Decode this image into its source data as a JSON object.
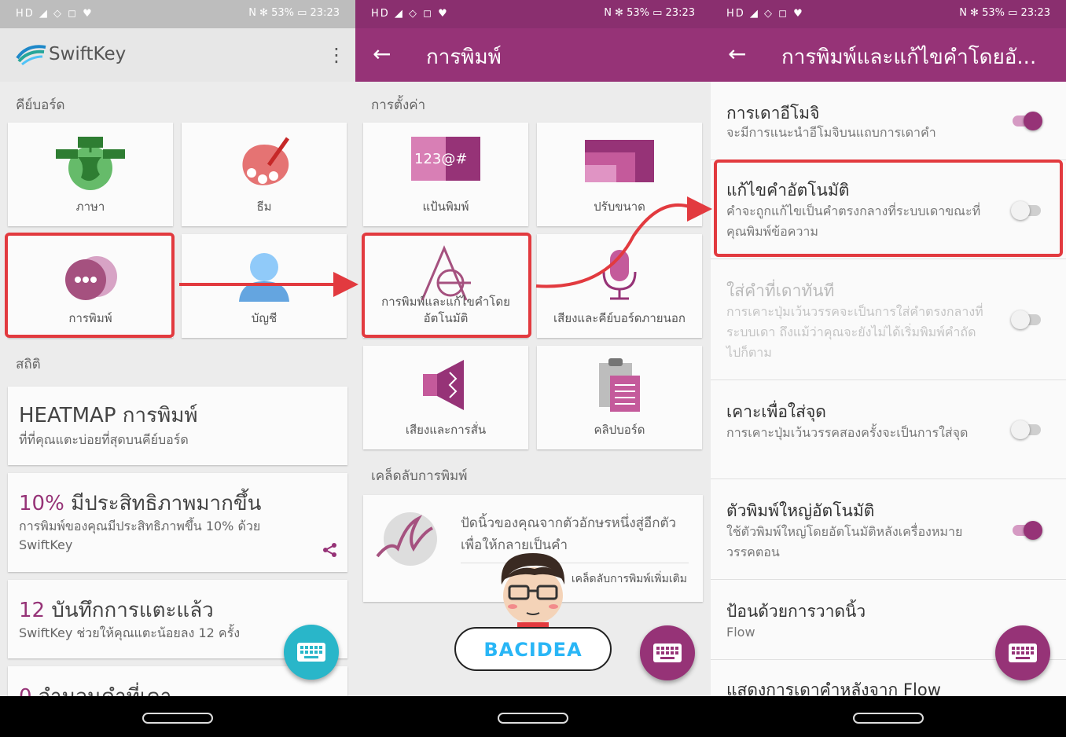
{
  "status": {
    "left_icons": "HD ◢ ◇ ◻ ♥",
    "right_text": "N ✻ 53% ▭ 23:23"
  },
  "panel1": {
    "app_name": "SwiftKey",
    "more_icon": "⋮",
    "keyboard_section": "คีย์บอร์ด",
    "tiles": [
      {
        "label": "ภาษา",
        "icon": "globe-icon"
      },
      {
        "label": "ธีม",
        "icon": "palette-icon"
      },
      {
        "label": "การพิมพ์",
        "icon": "chat-bubbles-icon"
      },
      {
        "label": "บัญชี",
        "icon": "account-icon"
      }
    ],
    "stats_section": "สถิติ",
    "cards": [
      {
        "title": "HEATMAP การพิมพ์",
        "subtitle": "ที่ที่คุณแตะบ่อยที่สุดบนคีย์บอร์ด"
      },
      {
        "number": "10%",
        "title": "มีประสิทธิภาพมากขึ้น",
        "subtitle": "การพิมพ์ของคุณมีประสิทธิภาพขึ้น 10% ด้วย SwiftKey"
      },
      {
        "number": "12",
        "title": "บันทึกการแตะแล้ว",
        "subtitle": "SwiftKey ช่วยให้คุณแตะน้อยลง 12 ครั้ง"
      },
      {
        "number": "0",
        "title": "จำนวนคำที่เดา"
      }
    ]
  },
  "panel2": {
    "back": "←",
    "title": "การพิมพ์",
    "settings_section": "การตั้งค่า",
    "tiles": [
      {
        "label": "แป้นพิมพ์",
        "icon": "keyboard-layout-icon"
      },
      {
        "label": "ปรับขนาด",
        "icon": "resize-icon"
      },
      {
        "label": "การพิมพ์และแก้ไขคำโดยอัตโนมัติ",
        "icon": "typing-autocorrect-icon"
      },
      {
        "label": "เสียงและคีย์บอร์ดภายนอก",
        "icon": "microphone-icon"
      },
      {
        "label": "เสียงและการสั่น",
        "icon": "speaker-icon"
      },
      {
        "label": "คลิปบอร์ด",
        "icon": "clipboard-icon"
      }
    ],
    "tips_section": "เคล็ดลับการพิมพ์",
    "tip_text": "ปัดนิ้วของคุณจากตัวอักษรหนึ่งสู่อีกตัวเพื่อให้กลายเป็นคำ",
    "tip_link": "เคล็ดลับการพิมพ์เพิ่มเติม",
    "watermark": "BACIDEA"
  },
  "panel3": {
    "back": "←",
    "title": "การพิมพ์และแก้ไขคำโดยอั...",
    "rows": [
      {
        "title": "การเดาอีโมจิ",
        "subtitle": "จะมีการแนะนำอีโมจิบนแถบการเดาคำ",
        "toggle": true
      },
      {
        "title": "แก้ไขคำอัตโนมัติ",
        "subtitle": "คำจะถูกแก้ไขเป็นคำตรงกลางที่ระบบเดาขณะที่คุณพิมพ์ข้อความ",
        "toggle": false
      },
      {
        "title": "ใส่คำที่เดาทันที",
        "subtitle": "การเคาะปุ่มเว้นวรรคจะเป็นการใส่คำตรงกลางที่ระบบเดา ถึงแม้ว่าคุณจะยังไม่ได้เริ่มพิมพ์คำถัดไปก็ตาม",
        "toggle": false
      },
      {
        "title": "เคาะเพื่อใส่จุด",
        "subtitle": "การเคาะปุ่มเว้นวรรคสองครั้งจะเป็นการใส่จุด",
        "toggle": false
      },
      {
        "title": "ตัวพิมพ์ใหญ่อัตโนมัติ",
        "subtitle": "ใช้ตัวพิมพ์ใหญ่โดยอัตโนมัติหลังเครื่องหมายวรรคตอน",
        "toggle": true
      },
      {
        "title": "ป้อนด้วยการวาดนิ้ว",
        "subtitle": "Flow"
      },
      {
        "title": "แสดงการเดาคำหลังจาก Flow"
      }
    ]
  },
  "colors": {
    "accent": "#963377",
    "fab_teal": "#29b6c9",
    "highlight": "#e23a3f"
  }
}
